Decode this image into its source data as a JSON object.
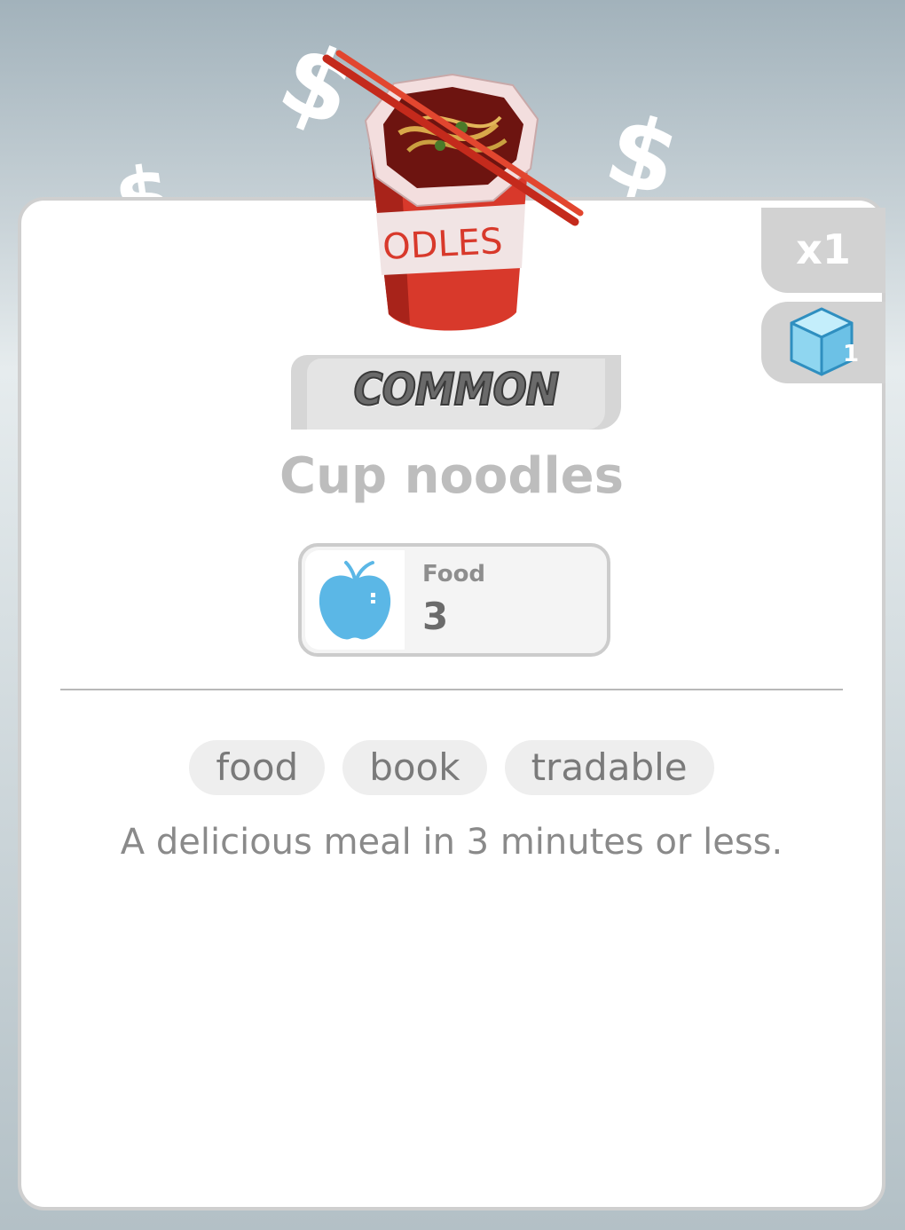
{
  "item": {
    "name": "Cup noodles",
    "rarity": "COMMON",
    "quantity": "x1",
    "cube_count": "1",
    "cup_label": "ODLES",
    "stat": {
      "label": "Food",
      "value": "3",
      "icon": "apple-icon"
    },
    "tags": [
      "food",
      "book",
      "tradable"
    ],
    "description": "A delicious meal in 3 minutes or less."
  },
  "background": {
    "dollar_symbols": [
      "$",
      "$",
      "$"
    ]
  },
  "colors": {
    "card_bg": "#ffffff",
    "tab_bg": "#d2d2d2",
    "apple_blue": "#5bb7e6",
    "cube_blue": "#8fd6f0",
    "cup_red": "#d8392b"
  }
}
